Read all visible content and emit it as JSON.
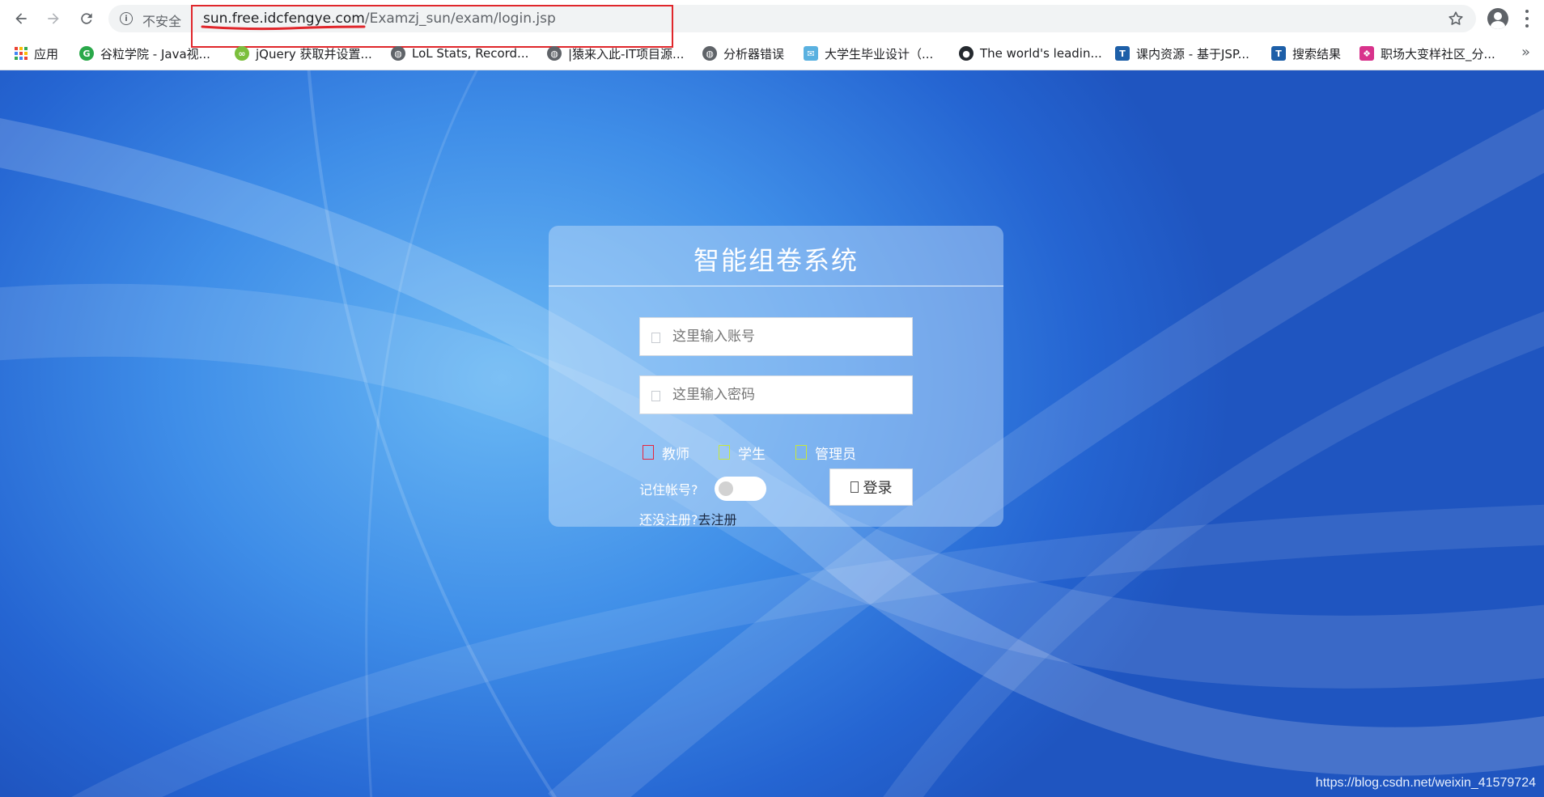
{
  "browser": {
    "not_secure": "不安全",
    "url_host": "sun.free.idcfengye.com",
    "url_path": "/Examzj_sun/exam/login.jsp"
  },
  "bookmarks": {
    "items": [
      {
        "label": "应用",
        "icon": "apps-grid-icon"
      },
      {
        "label": "谷粒学院 - Java视...",
        "icon": "guli-g-icon",
        "color": "#2aa84a"
      },
      {
        "label": "jQuery 获取并设置...",
        "icon": "wechat-bubble-icon",
        "color": "#7bbf3c"
      },
      {
        "label": "LoL Stats, Record...",
        "icon": "globe-icon",
        "color": "#5f6368"
      },
      {
        "label": "|猿来入此-IT项目源...",
        "icon": "globe-icon",
        "color": "#5f6368"
      },
      {
        "label": "分析器错误",
        "icon": "globe-icon",
        "color": "#5f6368"
      },
      {
        "label": "大学生毕业设计（...",
        "icon": "mail-icon",
        "color": "#5ab1e0"
      },
      {
        "label": "The world's leadin...",
        "icon": "github-icon",
        "color": "#24292e"
      },
      {
        "label": "课内资源 - 基于JSP...",
        "icon": "tb-icon",
        "color": "#1d5fa8"
      },
      {
        "label": "搜索结果",
        "icon": "tb-icon",
        "color": "#1d5fa8"
      },
      {
        "label": "职场大变样社区_分...",
        "icon": "community-icon",
        "color": "#d8328b"
      }
    ],
    "more": "»"
  },
  "login": {
    "title": "智能组卷系统",
    "username_placeholder": "这里输入账号",
    "password_placeholder": "这里输入密码",
    "roles": [
      "教师",
      "学生",
      "管理员"
    ],
    "remember_label": "记住帐号?",
    "login_button": "登录",
    "register_prompt": "还没注册?",
    "register_link": "去注册"
  },
  "watermark": "https://blog.csdn.net/weixin_41579724",
  "colors": {
    "page_blue": "#2f78e0",
    "annotation_red": "#e0262b",
    "teacher_box": "#e8243d",
    "role_box": "#c7e83a"
  }
}
